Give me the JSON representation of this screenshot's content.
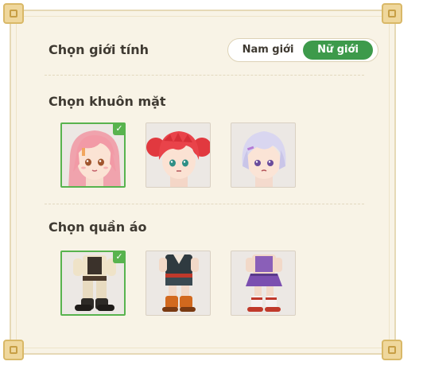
{
  "gender": {
    "label": "Chọn giới tính",
    "options": [
      "Nam giới",
      "Nữ giới"
    ],
    "selected": "Nữ giới"
  },
  "faces": {
    "label": "Chọn khuôn mặt",
    "items": [
      {
        "name": "pink-hair-girl-face",
        "selected": true
      },
      {
        "name": "red-hair-girl-face",
        "selected": false
      },
      {
        "name": "lavender-hair-girl-face",
        "selected": false
      }
    ]
  },
  "outfits": {
    "label": "Chọn quần áo",
    "items": [
      {
        "name": "beige-leather-outfit",
        "selected": true
      },
      {
        "name": "dark-teal-outfit",
        "selected": false
      },
      {
        "name": "purple-skirt-outfit",
        "selected": false
      }
    ]
  },
  "colors": {
    "accent": "#3d9a4b",
    "panel_bg": "#f8f3e6",
    "selected_border": "#58b34e"
  },
  "icons": {
    "check": "✓"
  }
}
